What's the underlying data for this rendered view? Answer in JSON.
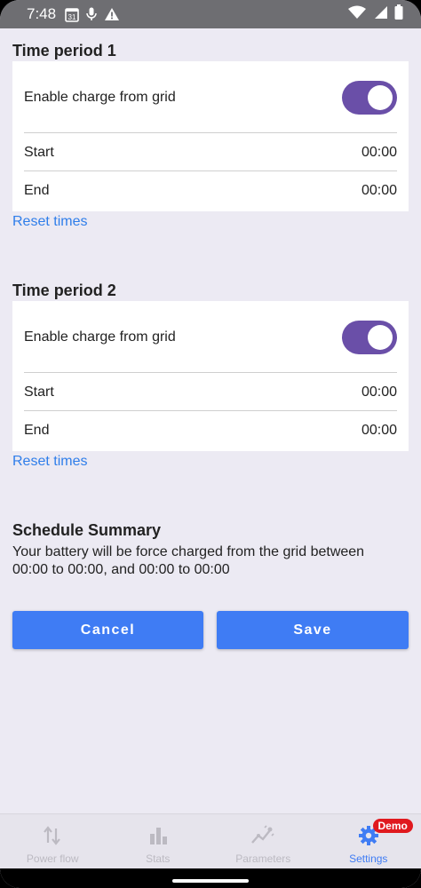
{
  "status_bar": {
    "time": "7:48",
    "calendar_day": "31",
    "icons": [
      "calendar-icon",
      "mic-icon",
      "warning-icon",
      "wifi-icon",
      "signal-icon",
      "battery-icon"
    ]
  },
  "periods": [
    {
      "title": "Time period 1",
      "enable_label": "Enable charge from grid",
      "enabled": true,
      "start_label": "Start",
      "start_value": "00:00",
      "end_label": "End",
      "end_value": "00:00",
      "reset_label": "Reset times"
    },
    {
      "title": "Time period 2",
      "enable_label": "Enable charge from grid",
      "enabled": true,
      "start_label": "Start",
      "start_value": "00:00",
      "end_label": "End",
      "end_value": "00:00",
      "reset_label": "Reset times"
    }
  ],
  "summary": {
    "title": "Schedule Summary",
    "text": "Your battery will be force charged from the grid between 00:00 to 00:00, and 00:00 to 00:00"
  },
  "buttons": {
    "cancel": "Cancel",
    "save": "Save"
  },
  "nav": {
    "items": [
      {
        "label": "Power flow",
        "icon": "power-flow-icon"
      },
      {
        "label": "Stats",
        "icon": "stats-icon"
      },
      {
        "label": "Parameters",
        "icon": "parameters-icon"
      },
      {
        "label": "Settings",
        "icon": "gear-icon"
      }
    ],
    "active": "Settings",
    "badge": "Demo"
  },
  "colors": {
    "accent": "#3F7CF4",
    "toggle": "#6A4FA8",
    "link": "#2F7EEA",
    "badge": "#E0191E",
    "background": "#ECEAF3"
  }
}
